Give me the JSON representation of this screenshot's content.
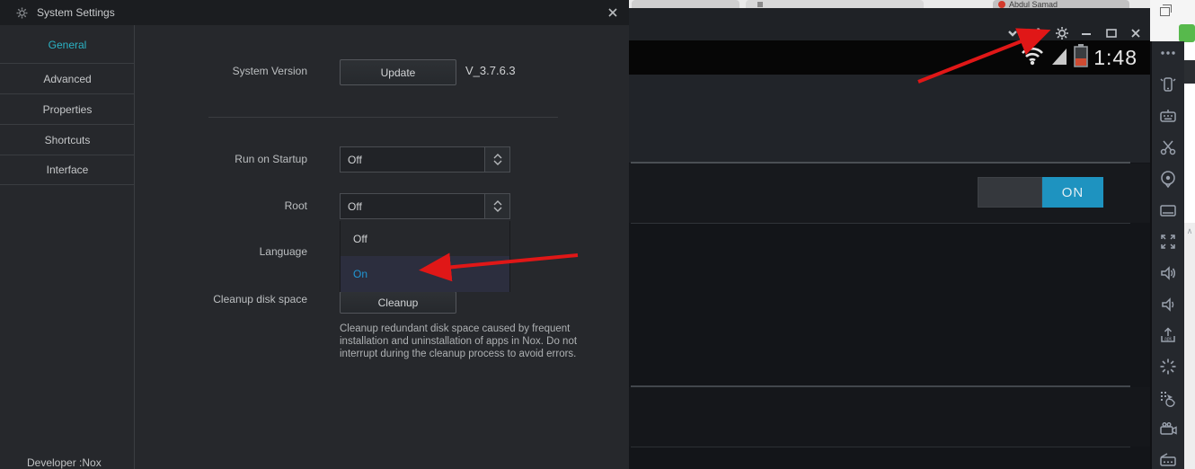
{
  "colors": {
    "accent_teal": "#2BB3C5",
    "option_blue": "#2196D4",
    "toggle_blue": "#1E93C0",
    "arrow_red": "#E01717",
    "battery_orange": "#CF4B32"
  },
  "browser": {
    "visible_tab": "Abdul Samad"
  },
  "settings_window": {
    "title": "System Settings",
    "sidebar": [
      {
        "label": "General",
        "active": true
      },
      {
        "label": "Advanced",
        "active": false
      },
      {
        "label": "Properties",
        "active": false
      },
      {
        "label": "Shortcuts",
        "active": false
      },
      {
        "label": "Interface",
        "active": false
      }
    ],
    "rows": {
      "system_version": {
        "label": "System Version",
        "button": "Update",
        "value": "V_3.7.6.3"
      },
      "run_on_startup": {
        "label": "Run on Startup",
        "value": "Off"
      },
      "root": {
        "label": "Root",
        "value": "Off"
      },
      "root_dropdown": {
        "options": [
          "Off",
          "On"
        ],
        "highlighted": "On"
      },
      "language": {
        "label": "Language"
      },
      "cleanup": {
        "label": "Cleanup disk space",
        "button": "Cleanup",
        "description": "Cleanup redundant disk space caused by frequent installation and uninstallation of apps in Nox. Do not interrupt during the cleanup process to avoid errors."
      }
    },
    "footer": "Developer :Nox"
  },
  "emulator": {
    "window_controls": [
      "collapse",
      "pin",
      "settings",
      "minimize",
      "maximize",
      "close"
    ],
    "status_bar": {
      "time": "1:48"
    },
    "toggle": {
      "label": "ON",
      "state": "on"
    },
    "sidebar_icons": [
      "more-options",
      "shake-device",
      "virtual-keyboard",
      "cut",
      "location",
      "bank-card",
      "fullscreen",
      "volume-up",
      "volume-down",
      "apk-install",
      "restart",
      "macro-recorder",
      "video-recorder",
      "keyboard"
    ]
  }
}
